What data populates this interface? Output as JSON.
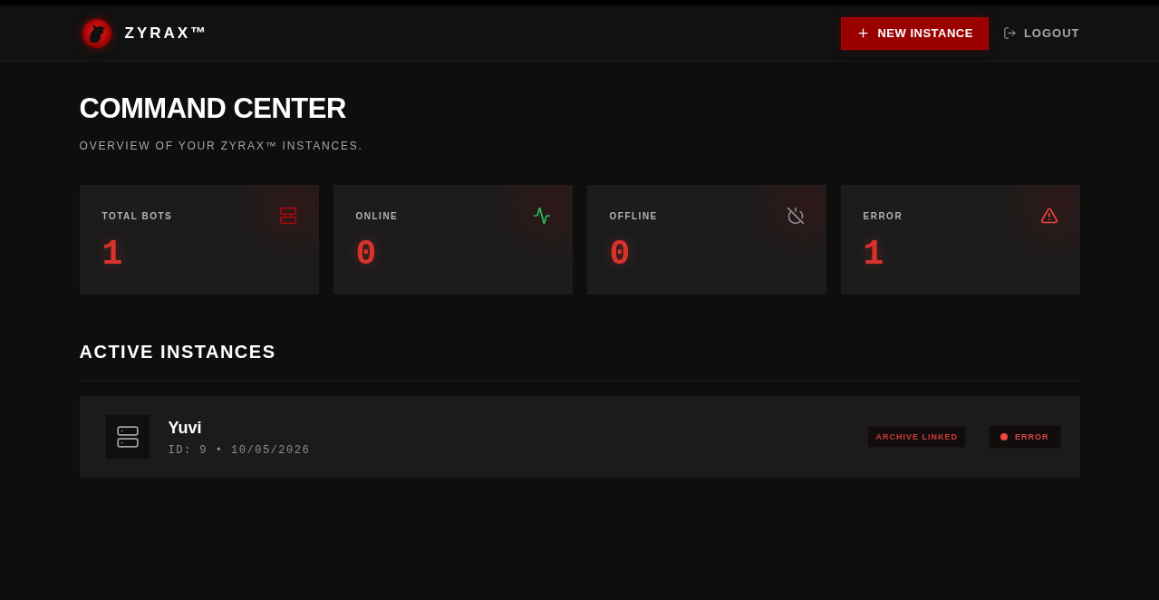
{
  "header": {
    "brand": "ZYRAX™",
    "actions": [
      {
        "kind": "primary",
        "label": "NEW INSTANCE"
      },
      {
        "kind": "link",
        "label": "LOGOUT"
      }
    ]
  },
  "page": {
    "title": "COMMAND CENTER",
    "subtitle": "OVERVIEW OF YOUR ZYRAX™ INSTANCES."
  },
  "stats": [
    {
      "kind": "total",
      "label": "TOTAL BOTS",
      "value": "1",
      "color": "#a30d0d"
    },
    {
      "kind": "online",
      "label": "ONLINE",
      "value": "0",
      "color": "#22c55e"
    },
    {
      "kind": "offline",
      "label": "OFFLINE",
      "value": "0",
      "color": "#8a8a90"
    },
    {
      "kind": "error",
      "label": "ERROR",
      "value": "1",
      "color": "#ef4444"
    }
  ],
  "instances_section": {
    "title": "ACTIVE INSTANCES",
    "instances": [
      {
        "name": "Yuvi",
        "meta": "ID: 9 • 10/05/2026",
        "tags": [
          {
            "kind": "tag",
            "label": "ARCHIVE LINKED"
          },
          {
            "kind": "status",
            "label": "ERROR",
            "color": "#ef4444"
          }
        ]
      }
    ]
  }
}
